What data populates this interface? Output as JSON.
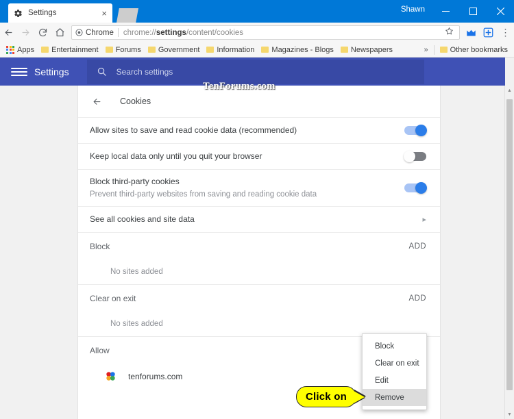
{
  "window": {
    "user": "Shawn",
    "minimize_label": "minimize-icon",
    "maximize_label": "maximize-icon",
    "close_label": "close-icon"
  },
  "tab": {
    "title": "Settings",
    "favicon": "gear-icon",
    "close_label": "×",
    "new_tab_label": "new-tab"
  },
  "toolbar": {
    "back_label": "←",
    "forward_label": "→",
    "reload_label": "reload-icon",
    "home_label": "home-icon",
    "chip_label": "Chrome",
    "url_prefix": "chrome://",
    "url_bold": "settings",
    "url_suffix": "/content/cookies",
    "star_label": "bookmark-star-icon",
    "ext1_label": "extension-icon",
    "ext2_label": "extension-icon",
    "menu_label": "⋮"
  },
  "bookmarks": {
    "apps_label": "Apps",
    "items": [
      {
        "label": "Entertainment"
      },
      {
        "label": "Forums"
      },
      {
        "label": "Government"
      },
      {
        "label": "Information"
      },
      {
        "label": "Magazines - Blogs"
      },
      {
        "label": "Newspapers"
      }
    ],
    "overflow_label": "»",
    "other_label": "Other bookmarks"
  },
  "settings_bar": {
    "title": "Settings",
    "search_placeholder": "Search settings"
  },
  "watermark": "TenForums.com",
  "page": {
    "header_title": "Cookies",
    "rows": [
      {
        "title": "Allow sites to save and read cookie data (recommended)",
        "sub": "",
        "toggle": "on"
      },
      {
        "title": "Keep local data only until you quit your browser",
        "sub": "",
        "toggle": "off"
      },
      {
        "title": "Block third-party cookies",
        "sub": "Prevent third-party websites from saving and reading cookie data",
        "toggle": "on"
      }
    ],
    "see_all": {
      "title": "See all cookies and site data",
      "chevron": "▸"
    },
    "sections": [
      {
        "title": "Block",
        "add_label": "ADD",
        "empty_text": "No sites added",
        "sites": []
      },
      {
        "title": "Clear on exit",
        "add_label": "ADD",
        "empty_text": "No sites added",
        "sites": []
      },
      {
        "title": "Allow",
        "add_label": "",
        "empty_text": "",
        "sites": [
          {
            "name": "tenforums.com"
          }
        ]
      }
    ]
  },
  "context_menu": {
    "items": [
      {
        "label": "Block",
        "highlighted": false
      },
      {
        "label": "Clear on exit",
        "highlighted": false
      },
      {
        "label": "Edit",
        "highlighted": false
      },
      {
        "label": "Remove",
        "highlighted": true
      }
    ]
  },
  "callout": {
    "text": "Click on"
  },
  "scrollbar": {
    "up_arrow": "▲",
    "down_arrow": "▼"
  },
  "colors": {
    "window_blue": "#0078d7",
    "settings_blue": "#3f51b5",
    "toggle_on": "#2b7de9",
    "callout_yellow": "#ffff00"
  }
}
